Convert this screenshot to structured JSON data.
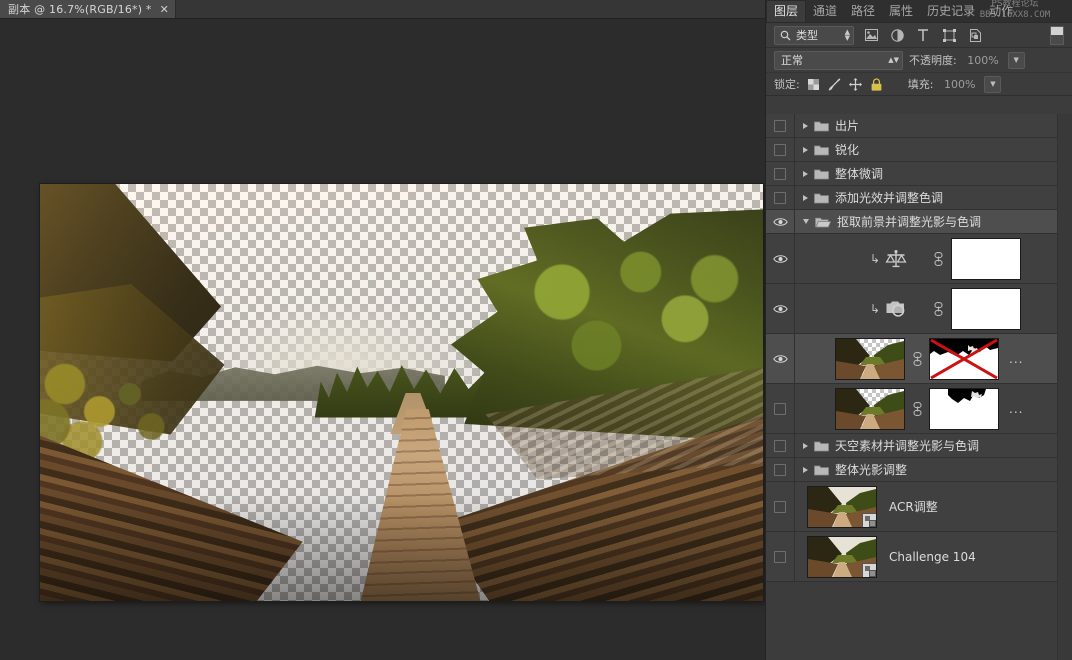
{
  "document_tab": {
    "title": "副本 @ 16.7%(RGB/16*) *",
    "close_label": "✕"
  },
  "watermark": {
    "line1": "PS教程论坛",
    "line2": "BBS.16XX8.COM"
  },
  "panel": {
    "tabs": [
      {
        "label": "图层",
        "active": true
      },
      {
        "label": "通道",
        "active": false
      },
      {
        "label": "路径",
        "active": false
      },
      {
        "label": "属性",
        "active": false
      },
      {
        "label": "历史记录",
        "active": false
      },
      {
        "label": "动作",
        "active": false
      }
    ],
    "filter_bar": {
      "kind_label": "类型",
      "search_icon": "search-icon",
      "icons": [
        "pixel-filter-icon",
        "adjustment-filter-icon",
        "type-filter-icon",
        "shape-filter-icon",
        "smart-object-filter-icon"
      ],
      "toggle": "filter-enable-toggle"
    },
    "blend_row": {
      "blend_mode": "正常",
      "opacity_label": "不透明度:",
      "opacity_value": "100%"
    },
    "lock_row": {
      "lock_label": "锁定:",
      "lock_icons": [
        "lock-transparency-icon",
        "lock-image-pixels-icon",
        "lock-position-icon",
        "lock-all-icon"
      ],
      "fill_label": "填充:",
      "fill_value": "100%"
    }
  },
  "layers": [
    {
      "type": "group",
      "name": "出片",
      "visible": false,
      "expanded": false,
      "selected": false
    },
    {
      "type": "group",
      "name": "锐化",
      "visible": false,
      "expanded": false,
      "selected": false
    },
    {
      "type": "group",
      "name": "整体微调",
      "visible": false,
      "expanded": false,
      "selected": false
    },
    {
      "type": "group",
      "name": "添加光效并调整色调",
      "visible": false,
      "expanded": false,
      "selected": false
    },
    {
      "type": "group",
      "name": "抠取前景并调整光影与色调",
      "visible": true,
      "expanded": true,
      "selected": true
    },
    {
      "type": "adjustment",
      "name": "",
      "icon": "color-balance-icon",
      "clipped": true,
      "visible": true,
      "selected": false,
      "mask": "white"
    },
    {
      "type": "adjustment",
      "name": "",
      "icon": "photo-filter-icon",
      "clipped": true,
      "visible": true,
      "selected": false,
      "mask": "white"
    },
    {
      "type": "pixel",
      "name": "...",
      "visible": true,
      "selected": true,
      "mask": "black-top",
      "mask_disabled": true
    },
    {
      "type": "pixel",
      "name": "...",
      "visible": false,
      "selected": false,
      "mask": "black-top-small",
      "mask_disabled": false
    },
    {
      "type": "group",
      "name": "天空素材并调整光影与色调",
      "visible": false,
      "expanded": false,
      "selected": false
    },
    {
      "type": "group",
      "name": "整体光影调整",
      "visible": false,
      "expanded": false,
      "selected": false
    },
    {
      "type": "smart-object",
      "name": "ACR调整",
      "visible": false,
      "selected": false
    },
    {
      "type": "smart-object",
      "name": "Challenge 104",
      "visible": false,
      "selected": false
    }
  ],
  "colors": {
    "panel_bg": "#3c3c3c",
    "row_bg": "#404040",
    "row_selected": "#4e4e4e",
    "doc_bg": "#2c2c2c",
    "tab_active": "#4a4a4a",
    "mask_disabled_x": "#cc1111",
    "text": "#dcdcdc"
  }
}
